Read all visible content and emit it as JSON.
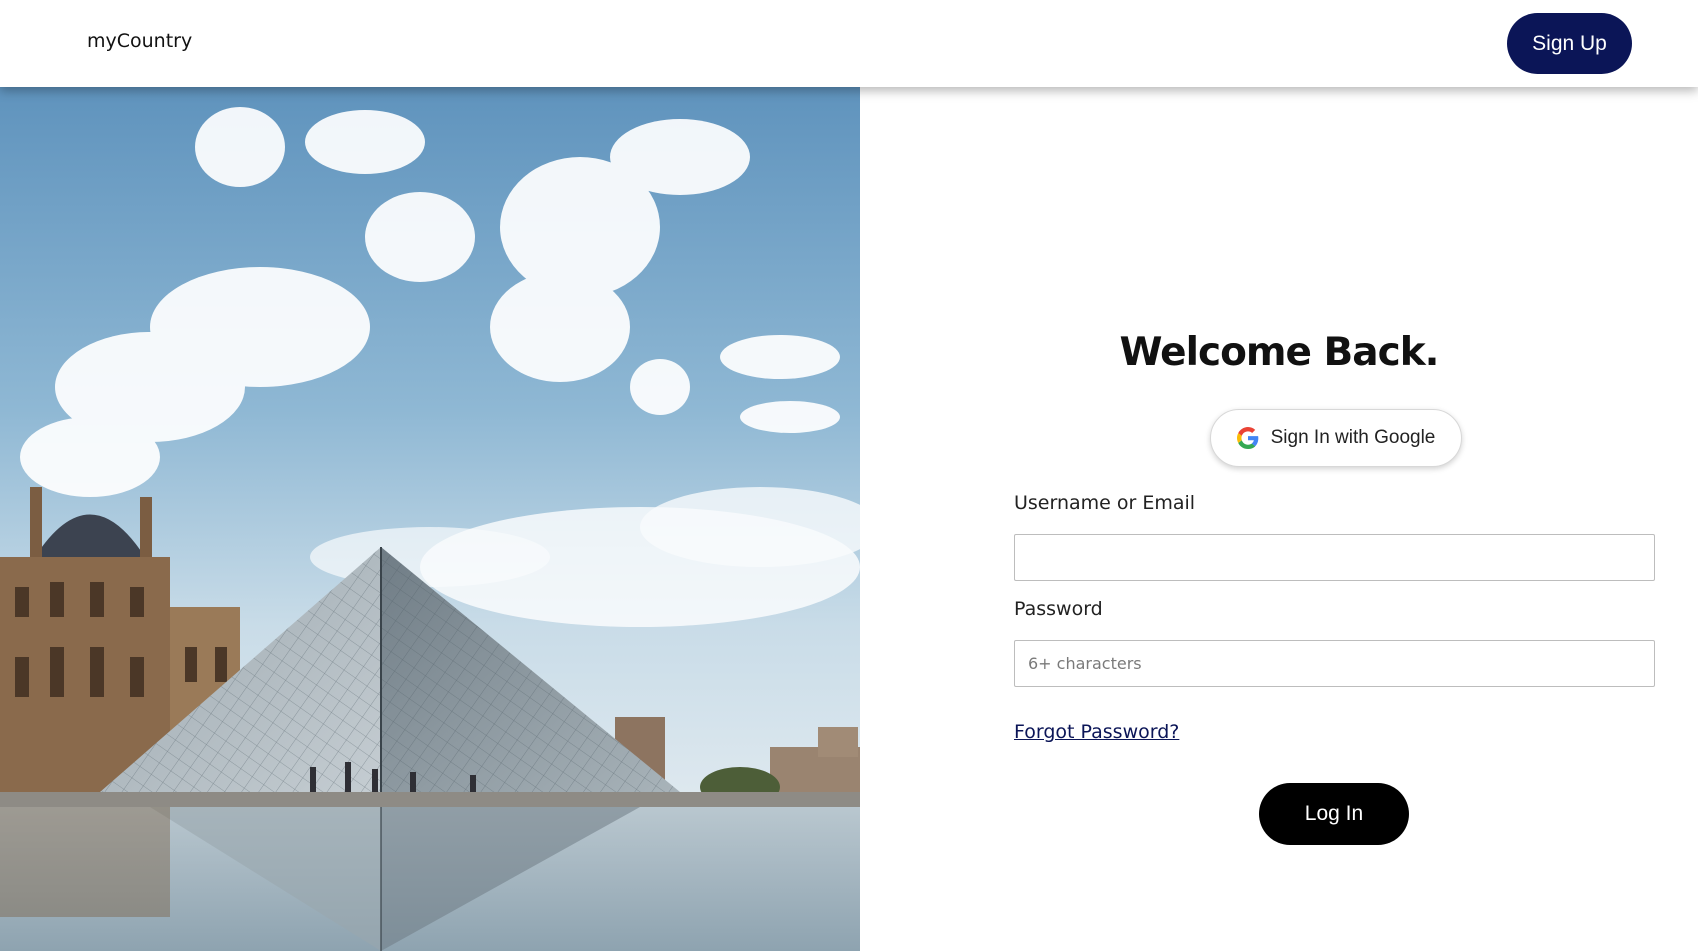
{
  "header": {
    "brand": "myCountry",
    "signup_label": "Sign Up"
  },
  "hero": {
    "image_alt": "Louvre glass pyramid under a cloudy blue sky with reflection in water"
  },
  "login": {
    "title": "Welcome Back.",
    "google_label": "Sign In with Google",
    "username_label": "Username or Email",
    "username_value": "",
    "password_label": "Password",
    "password_placeholder": "6+ characters",
    "forgot_label": "Forgot Password?",
    "login_label": "Log In"
  },
  "colors": {
    "primary_navy": "#0b1557",
    "button_black": "#000000",
    "sky_blue": "#8fb8d4"
  }
}
